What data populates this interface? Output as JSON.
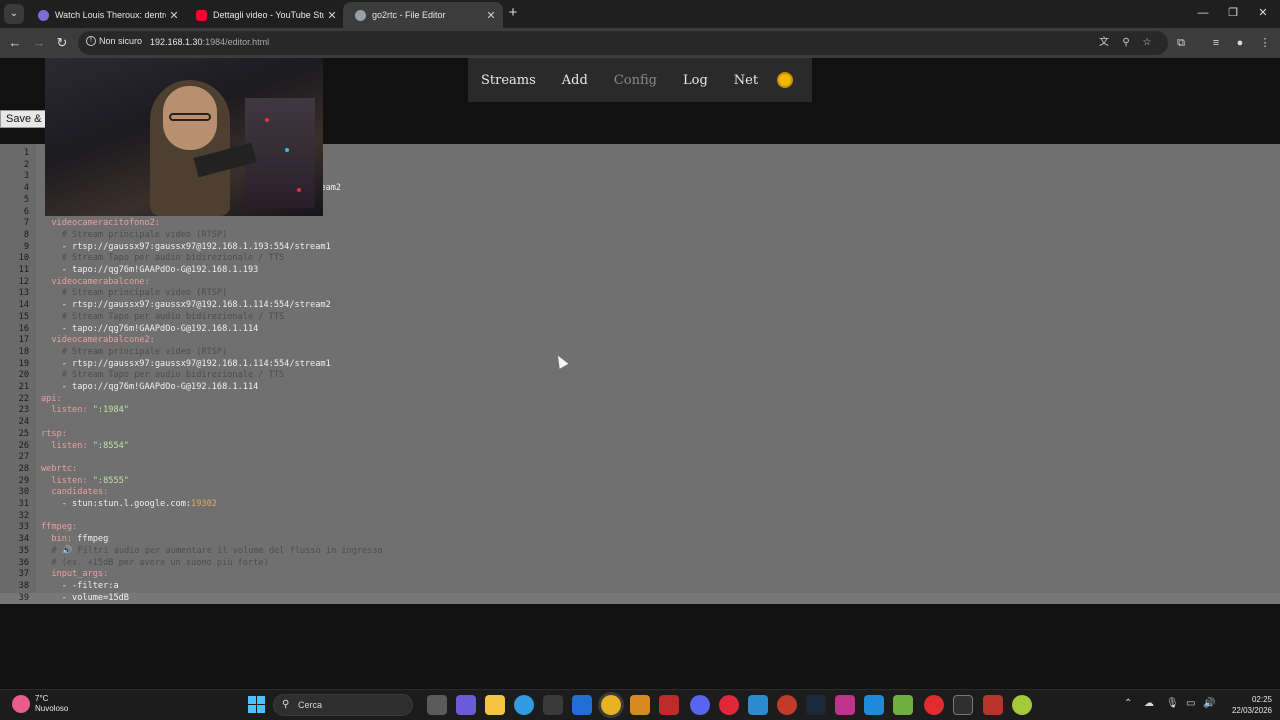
{
  "browser": {
    "tabs": [
      {
        "title": "Watch Louis Theroux: dentro la",
        "favicon_color": "#7e6bd6",
        "active": false
      },
      {
        "title": "Dettagli video - YouTube Studio",
        "favicon_color": "#ff0033",
        "active": false
      },
      {
        "title": "go2rtc - File Editor",
        "favicon_color": "#9aa0a6",
        "active": true
      }
    ],
    "security_label": "Non sicuro",
    "url_host": "192.168.1.30",
    "url_path": ":1984/editor.html"
  },
  "page": {
    "nav": [
      {
        "label": "Streams",
        "dim": false
      },
      {
        "label": "Add",
        "dim": false
      },
      {
        "label": "Config",
        "dim": true
      },
      {
        "label": "Log",
        "dim": false
      },
      {
        "label": "Net",
        "dim": false
      }
    ],
    "save_label": "Save &"
  },
  "editor": {
    "lines": [
      {
        "n": "1",
        "segs": [
          {
            "t": "",
            "c": "v"
          }
        ]
      },
      {
        "n": "2",
        "segs": [
          {
            "t": "",
            "c": "v"
          }
        ]
      },
      {
        "n": "3",
        "segs": [
          {
            "t": "",
            "c": "v"
          }
        ]
      },
      {
        "n": "4",
        "segs": [
          {
            "t": "                                                     ream2",
            "c": "v"
          }
        ]
      },
      {
        "n": "5",
        "segs": [
          {
            "t": "",
            "c": "v"
          }
        ]
      },
      {
        "n": "6",
        "segs": [
          {
            "t": "",
            "c": "v"
          }
        ]
      },
      {
        "n": "7",
        "segs": [
          {
            "t": "  videocameracitofono2:",
            "c": "k"
          }
        ]
      },
      {
        "n": "8",
        "segs": [
          {
            "t": "    # Stream principale video (RTSP)",
            "c": "c"
          }
        ]
      },
      {
        "n": "9",
        "segs": [
          {
            "t": "    - ",
            "c": "v"
          },
          {
            "t": "rtsp://gaussx97:gaussx97@192.168.1.193:554/stream1",
            "c": "v"
          }
        ]
      },
      {
        "n": "10",
        "segs": [
          {
            "t": "    # Stream Tapo per audio bidirezionale / TTS",
            "c": "c"
          }
        ]
      },
      {
        "n": "11",
        "segs": [
          {
            "t": "    - ",
            "c": "v"
          },
          {
            "t": "tapo://qg76m!GAAPdOo-G@192.168.1.193",
            "c": "v"
          }
        ]
      },
      {
        "n": "12",
        "segs": [
          {
            "t": "  videocamerabalcone:",
            "c": "k"
          }
        ]
      },
      {
        "n": "13",
        "segs": [
          {
            "t": "    # Stream principale video (RTSP)",
            "c": "c"
          }
        ]
      },
      {
        "n": "14",
        "segs": [
          {
            "t": "    - ",
            "c": "v"
          },
          {
            "t": "rtsp://gaussx97:gaussx97@192.168.1.114:554/stream2",
            "c": "v"
          }
        ]
      },
      {
        "n": "15",
        "segs": [
          {
            "t": "    # Stream Tapo per audio bidirezionale / TTS",
            "c": "c"
          }
        ]
      },
      {
        "n": "16",
        "segs": [
          {
            "t": "    - ",
            "c": "v"
          },
          {
            "t": "tapo://qg76m!GAAPdOo-G@192.168.1.114",
            "c": "v"
          }
        ]
      },
      {
        "n": "17",
        "segs": [
          {
            "t": "  videocamerabalcone2:",
            "c": "k"
          }
        ]
      },
      {
        "n": "18",
        "segs": [
          {
            "t": "    # Stream principale video (RTSP)",
            "c": "c"
          }
        ]
      },
      {
        "n": "19",
        "segs": [
          {
            "t": "    - ",
            "c": "v"
          },
          {
            "t": "rtsp://gaussx97:gaussx97@192.168.1.114:554/stream1",
            "c": "v"
          }
        ]
      },
      {
        "n": "20",
        "segs": [
          {
            "t": "    # Stream Tapo per audio bidirezionale / TTS",
            "c": "c"
          }
        ]
      },
      {
        "n": "21",
        "segs": [
          {
            "t": "    - ",
            "c": "v"
          },
          {
            "t": "tapo://qg76m!GAAPdOo-G@192.168.1.114",
            "c": "v"
          }
        ]
      },
      {
        "n": "22",
        "segs": [
          {
            "t": "api:",
            "c": "k"
          }
        ]
      },
      {
        "n": "23",
        "segs": [
          {
            "t": "  listen: ",
            "c": "k"
          },
          {
            "t": "\":1984\"",
            "c": "s"
          }
        ]
      },
      {
        "n": "24",
        "segs": [
          {
            "t": "",
            "c": "v"
          }
        ]
      },
      {
        "n": "25",
        "segs": [
          {
            "t": "rtsp:",
            "c": "k"
          }
        ]
      },
      {
        "n": "26",
        "segs": [
          {
            "t": "  listen: ",
            "c": "k"
          },
          {
            "t": "\":8554\"",
            "c": "s"
          }
        ]
      },
      {
        "n": "27",
        "segs": [
          {
            "t": "",
            "c": "v"
          }
        ]
      },
      {
        "n": "28",
        "segs": [
          {
            "t": "webrtc:",
            "c": "k"
          }
        ]
      },
      {
        "n": "29",
        "segs": [
          {
            "t": "  listen: ",
            "c": "k"
          },
          {
            "t": "\":8555\"",
            "c": "s"
          }
        ]
      },
      {
        "n": "30",
        "segs": [
          {
            "t": "  candidates:",
            "c": "k"
          }
        ]
      },
      {
        "n": "31",
        "segs": [
          {
            "t": "    - ",
            "c": "v"
          },
          {
            "t": "stun:stun.l.google.com:",
            "c": "v"
          },
          {
            "t": "19302",
            "c": "n"
          }
        ]
      },
      {
        "n": "32",
        "segs": [
          {
            "t": "",
            "c": "v"
          }
        ]
      },
      {
        "n": "33",
        "segs": [
          {
            "t": "ffmpeg:",
            "c": "k"
          }
        ]
      },
      {
        "n": "34",
        "segs": [
          {
            "t": "  bin: ",
            "c": "k"
          },
          {
            "t": "ffmpeg",
            "c": "v"
          }
        ]
      },
      {
        "n": "35",
        "segs": [
          {
            "t": "  # 🔊 Filtri audio per aumentare il volume del flusso in ingresso",
            "c": "c"
          }
        ]
      },
      {
        "n": "36",
        "segs": [
          {
            "t": "  # (es. +15dB per avere un suono più forte)",
            "c": "c"
          }
        ]
      },
      {
        "n": "37",
        "segs": [
          {
            "t": "  input_args:",
            "c": "k"
          }
        ]
      },
      {
        "n": "38",
        "segs": [
          {
            "t": "    - ",
            "c": "v"
          },
          {
            "t": "-filter:a",
            "c": "v"
          }
        ]
      },
      {
        "n": "39",
        "segs": [
          {
            "t": "    - ",
            "c": "v"
          },
          {
            "t": "volume=15dB",
            "c": "v"
          }
        ]
      }
    ]
  },
  "taskbar": {
    "weather_temp": "7°C",
    "weather_desc": "Nuvoloso",
    "search_label": "Cerca",
    "time": "02:25",
    "date": "22/03/2026"
  }
}
